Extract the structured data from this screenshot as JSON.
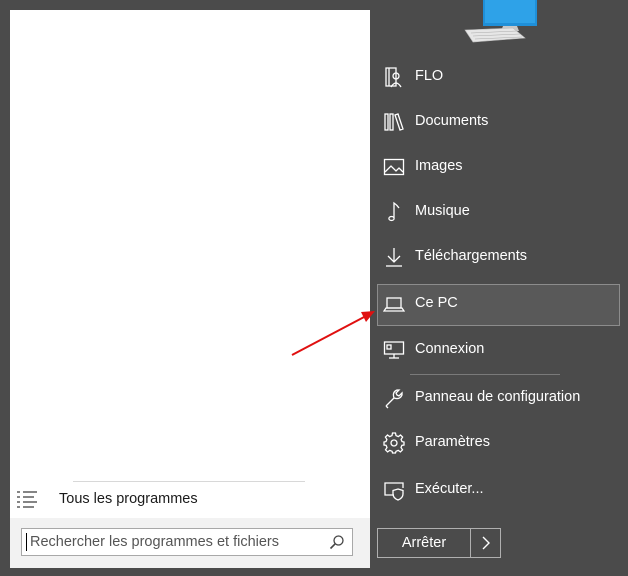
{
  "left_panel": {
    "all_programs_label": "Tous les programmes",
    "search": {
      "placeholder": "Rechercher les programmes et fichiers",
      "value": ""
    }
  },
  "right_panel": {
    "items": [
      {
        "label": "FLO",
        "icon": "user-folder-icon"
      },
      {
        "label": "Documents",
        "icon": "library-icon"
      },
      {
        "label": "Images",
        "icon": "image-icon"
      },
      {
        "label": "Musique",
        "icon": "music-note-icon"
      },
      {
        "label": "Téléchargements",
        "icon": "download-icon"
      },
      {
        "label": "Ce PC",
        "icon": "laptop-icon",
        "selected": true
      },
      {
        "label": "Connexion",
        "icon": "network-monitor-icon"
      },
      {
        "label": "Panneau de configuration",
        "icon": "wrench-icon"
      },
      {
        "label": "Paramètres",
        "icon": "gear-icon"
      },
      {
        "label": "Exécuter...",
        "icon": "run-icon"
      }
    ],
    "shutdown_label": "Arrêter"
  },
  "colors": {
    "panel_background": "#4b4b4b",
    "selection_border": "#8c8c8c",
    "annotation_arrow": "#e01010",
    "monitor_screen": "#2ea2e8"
  }
}
